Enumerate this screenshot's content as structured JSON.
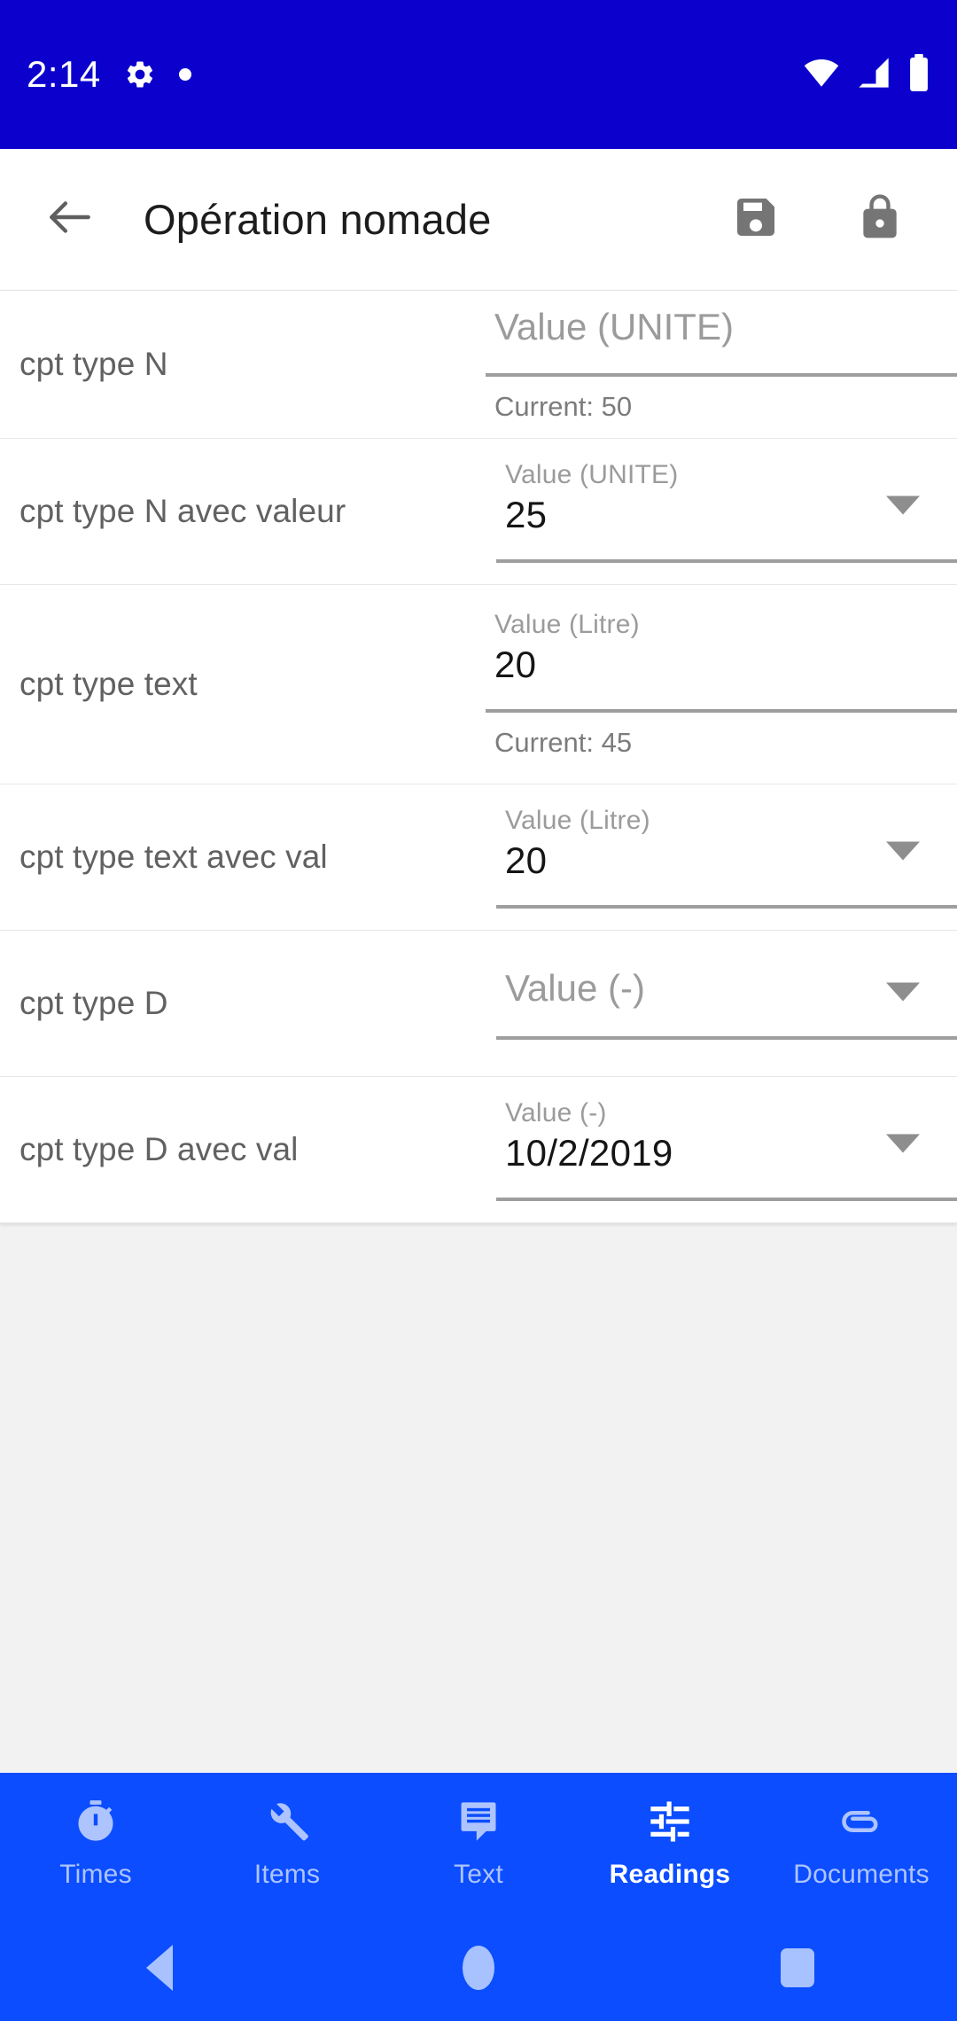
{
  "status_bar": {
    "time": "2:14",
    "icons_left": [
      "gear-icon",
      "dot-icon"
    ],
    "icons_right": [
      "wifi-icon",
      "cellular-icon",
      "battery-icon"
    ],
    "background": "#0b00cc"
  },
  "app_bar": {
    "back_icon": "back-arrow-icon",
    "title": "Opération nomade",
    "actions": [
      {
        "name": "save-icon",
        "label": "Save"
      },
      {
        "name": "lock-icon",
        "label": "Lock"
      }
    ],
    "background": "#ffffff"
  },
  "form": {
    "rows": [
      {
        "label": "cpt type N",
        "field_label": "",
        "placeholder": "Value (UNITE)",
        "value": "",
        "helper": "Current: 50",
        "has_dropdown": false
      },
      {
        "label": "cpt type N avec valeur",
        "field_label": "Value (UNITE)",
        "placeholder": "",
        "value": "25",
        "helper": "",
        "has_dropdown": true
      },
      {
        "label": "cpt type text",
        "field_label": "Value (Litre)",
        "placeholder": "",
        "value": "20",
        "helper": "Current: 45",
        "has_dropdown": false
      },
      {
        "label": "cpt type text avec val",
        "field_label": "Value (Litre)",
        "placeholder": "",
        "value": "20",
        "helper": "",
        "has_dropdown": true
      },
      {
        "label": "cpt type D",
        "field_label": "",
        "placeholder": "Value (-)",
        "value": "",
        "helper": "",
        "has_dropdown": true
      },
      {
        "label": "cpt type D avec val",
        "field_label": "Value (-)",
        "placeholder": "",
        "value": "10/2/2019",
        "helper": "",
        "has_dropdown": true
      }
    ]
  },
  "bottom_nav": {
    "background": "#0b4dff",
    "active_index": 3,
    "items": [
      {
        "label": "Times",
        "icon": "stopwatch-icon"
      },
      {
        "label": "Items",
        "icon": "wrench-icon"
      },
      {
        "label": "Text",
        "icon": "message-icon"
      },
      {
        "label": "Readings",
        "icon": "tune-sliders-icon"
      },
      {
        "label": "Documents",
        "icon": "attachment-icon"
      }
    ]
  },
  "system_nav": {
    "background": "#0b4dff",
    "buttons": [
      {
        "name": "system-back-button"
      },
      {
        "name": "system-home-button"
      },
      {
        "name": "system-recents-button"
      }
    ]
  }
}
